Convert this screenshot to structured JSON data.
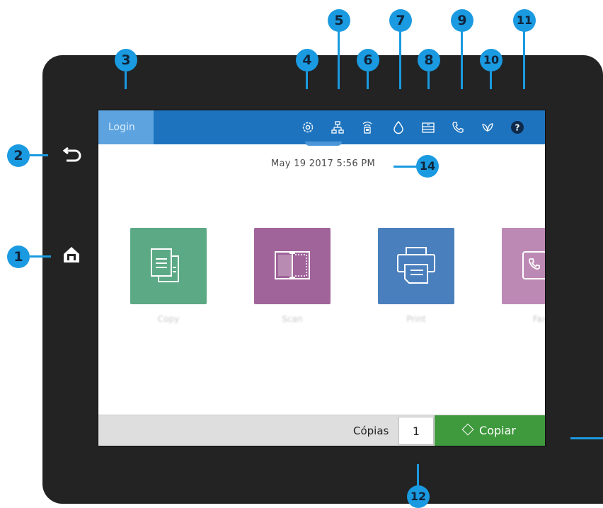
{
  "screen": {
    "topbar": {
      "login_label": "Login",
      "icons": [
        "settings-icon",
        "network-icon",
        "wireless-icon",
        "supplies-icon",
        "trays-icon",
        "fax-icon",
        "eco-icon",
        "help-icon"
      ],
      "help_glyph": "?"
    },
    "datetime": "May 19 2017  5:56 PM",
    "tiles": [
      {
        "label": "Copy",
        "color": "#5ca985"
      },
      {
        "label": "Scan",
        "color": "#a0649a"
      },
      {
        "label": "Print",
        "color": "#4a7fbe"
      },
      {
        "label": "Fax",
        "color": "#bc89b5"
      }
    ],
    "bottombar": {
      "copies_label": "Cópias",
      "copies_value": "1",
      "copy_button_label": "Copiar"
    }
  },
  "hardware": {
    "back_icon": "back-arrow-icon",
    "home_icon": "home-icon"
  },
  "callouts": [
    "1",
    "2",
    "3",
    "4",
    "5",
    "6",
    "7",
    "8",
    "9",
    "10",
    "11",
    "12",
    "14"
  ],
  "colors": {
    "accent": "#1a9ae0",
    "topbar": "#1e73be",
    "copy_button": "#3f9a3e",
    "panel": "#232323"
  }
}
